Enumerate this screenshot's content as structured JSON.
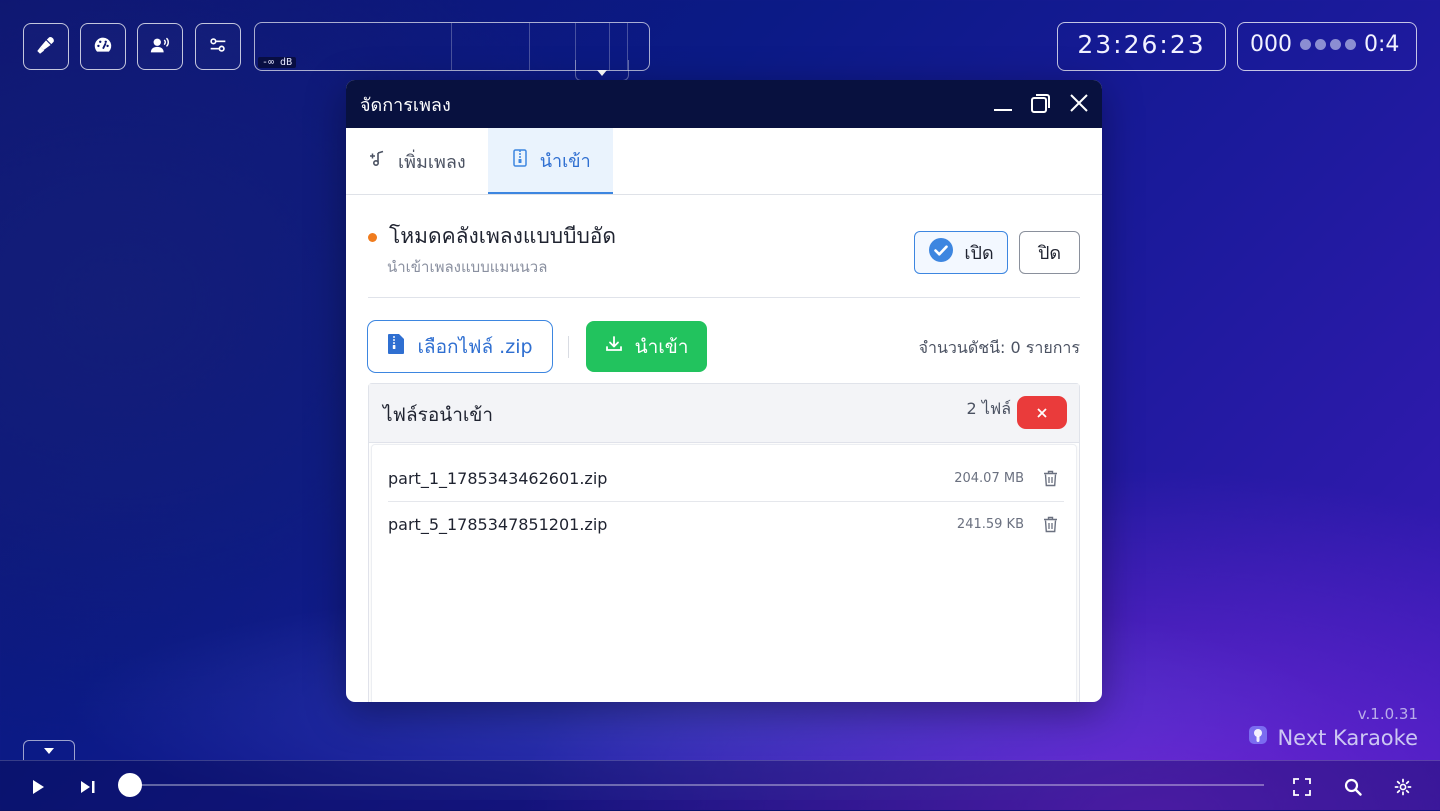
{
  "toolbar": {
    "buttons": [
      {
        "name": "microphone",
        "icon": "microphone-icon"
      },
      {
        "name": "dashboard",
        "icon": "gauge-icon"
      },
      {
        "name": "voice",
        "icon": "speaking-head-icon"
      },
      {
        "name": "mixer",
        "icon": "sliders-icon"
      }
    ],
    "meter_unit": "-∞ dB",
    "clock": "23:26:23",
    "score": {
      "value": "000",
      "time": "0:4",
      "dots": 4
    }
  },
  "dialog": {
    "title": "จัดการเพลง",
    "tabs": [
      {
        "label": "เพิ่มเพลง",
        "icon": "music-add-icon",
        "active": false
      },
      {
        "label": "นำเข้า",
        "icon": "zip-file-icon",
        "active": true
      }
    ],
    "mode": {
      "title": "โหมดคลังเพลงแบบบีบอัด",
      "subtitle": "นำเข้าเพลงแบบแมนนวล",
      "on_label": "เปิด",
      "off_label": "ปิด",
      "status_color": "#f07c1e"
    },
    "actions": {
      "choose_label": "เลือกไฟล์ .zip",
      "import_label": "นำเข้า",
      "index_count_text": "จำนวนดัชนี: 0 รายการ"
    },
    "pending": {
      "title": "ไฟล์รอนำเข้า",
      "count_text": "2 ไฟล์",
      "files": [
        {
          "name": "part_1_1785343462601.zip",
          "size": "204.07 MB"
        },
        {
          "name": "part_5_1785347851201.zip",
          "size": "241.59 KB"
        }
      ]
    }
  },
  "footer": {
    "version": "v.1.0.31",
    "brand": "Next Karaoke"
  },
  "player": {
    "progress": 0
  },
  "colors": {
    "accent": "#3d86e0",
    "success": "#22c35e",
    "danger": "#ea3b3b",
    "titlebar": "#08113f"
  }
}
